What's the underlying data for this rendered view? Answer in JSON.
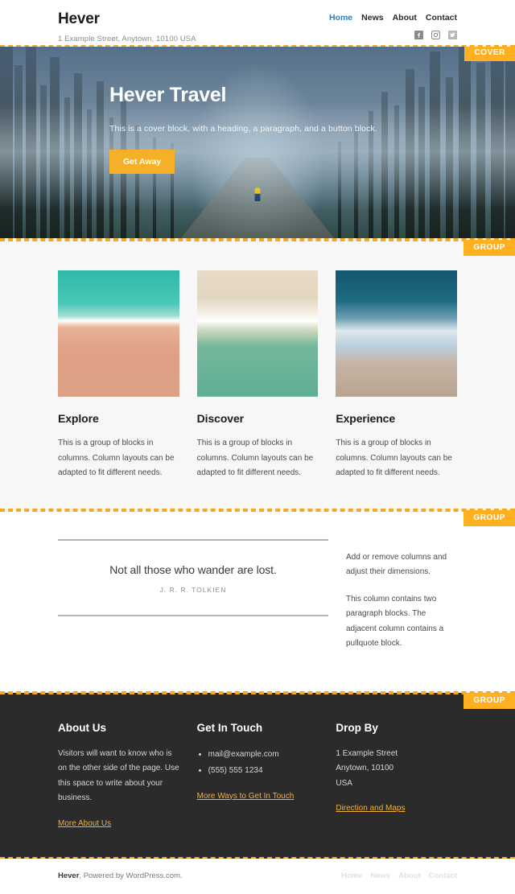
{
  "header": {
    "brand": "Hever",
    "tagline": "1 Example Street, Anytown, 10100 USA",
    "nav": [
      {
        "label": "Home",
        "current": true
      },
      {
        "label": "News",
        "current": false
      },
      {
        "label": "About",
        "current": false
      },
      {
        "label": "Contact",
        "current": false
      }
    ],
    "social": [
      {
        "name": "facebook-icon"
      },
      {
        "name": "instagram-icon"
      },
      {
        "name": "twitter-icon"
      }
    ]
  },
  "badges": {
    "cover": "COVER",
    "group": "GROUP"
  },
  "cover": {
    "heading": "Hever Travel",
    "paragraph": "This is a cover block, with a heading, a paragraph, and a button block.",
    "button": "Get Away",
    "image_alt": "foggy-forest-road-hiker"
  },
  "columns": [
    {
      "image_alt": "aerial-turquoise-sea-pink-sand",
      "heading": "Explore",
      "text": "This is a group of blocks in columns. Column layouts can be adapted to fit different needs."
    },
    {
      "image_alt": "aerial-pale-sand-green-water",
      "heading": "Discover",
      "text": "This is a group of blocks in columns. Column layouts can be adapted to fit different needs."
    },
    {
      "image_alt": "aerial-deep-blue-surf-beach",
      "heading": "Experience",
      "text": "This is a group of blocks in columns. Column layouts can be adapted to fit different needs."
    }
  ],
  "quote_section": {
    "quote": "Not all those who wander are lost.",
    "citation": "J. R. R. TOLKIEN",
    "paragraph_1": "Add or remove columns and adjust their dimensions.",
    "paragraph_2": "This column contains two paragraph blocks. The adjacent column contains a pullquote block."
  },
  "footer": {
    "columns": [
      {
        "heading": "About Us",
        "text": "Visitors will want to know who is on the other side of the page. Use this space to write about your business.",
        "link": "More About Us",
        "items": []
      },
      {
        "heading": "Get In Touch",
        "text": "",
        "link": "More Ways to Get In Touch",
        "items": [
          "mail@example.com",
          "(555) 555 1234"
        ]
      },
      {
        "heading": "Drop By",
        "text": "1 Example Street\nAnytown, 10100\nUSA",
        "link": "Direction and Maps",
        "items": []
      }
    ]
  },
  "bottom": {
    "credit_brand": "Hever",
    "credit_rest": ", Powered by ",
    "credit_link": "WordPress.com",
    "credit_end": ".",
    "nav": [
      "Home",
      "News",
      "About",
      "Contact"
    ]
  },
  "colors": {
    "accent": "#f5b027",
    "badge": "#ffb020",
    "link_active": "#2d7fc1",
    "footer_bg": "#2b2b2b",
    "footer_link": "#f2b134",
    "group_bg": "#f7f7f7"
  }
}
